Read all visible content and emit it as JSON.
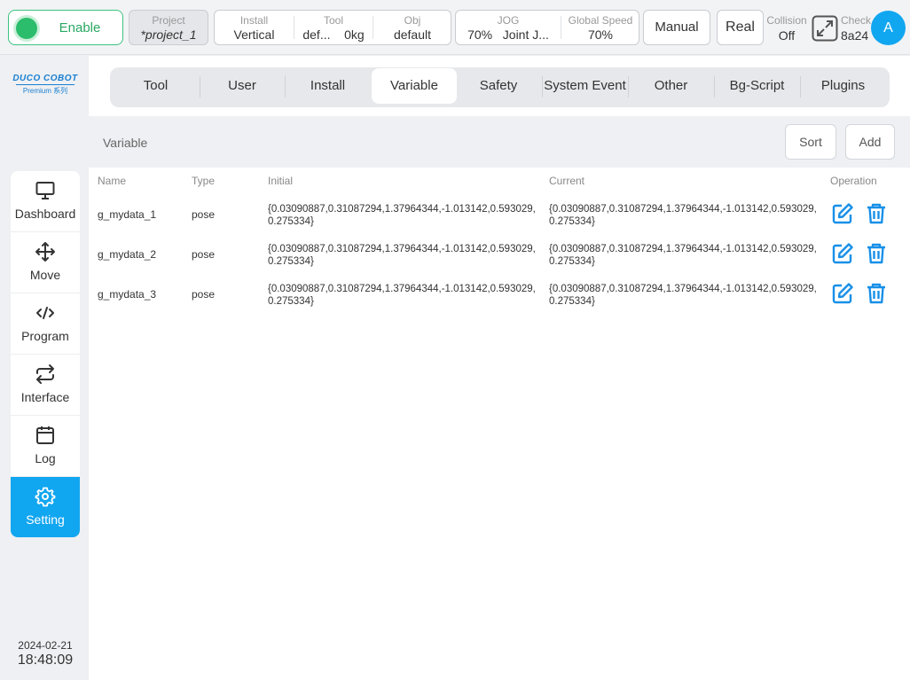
{
  "topbar": {
    "enable_label": "Enable",
    "project": {
      "label": "Project",
      "value": "*project_1"
    },
    "install": {
      "label": "Install",
      "value": "Vertical"
    },
    "tool": {
      "label": "Tool",
      "value1": "def...",
      "value2": "0kg"
    },
    "obj": {
      "label": "Obj",
      "value": "default"
    },
    "jog": {
      "label": "JOG",
      "value1": "70%",
      "value2": "Joint J..."
    },
    "global_speed": {
      "label": "Global Speed",
      "value": "70%"
    },
    "manual_label": "Manual",
    "real_label": "Real",
    "collision": {
      "label": "Collision",
      "value": "Off"
    },
    "check": {
      "label": "Check",
      "value": "8a24"
    },
    "avatar_letter": "A"
  },
  "logo": {
    "brand": "DUCO COBOT",
    "sub": "Premium 系列"
  },
  "nav": [
    {
      "label": "Dashboard",
      "icon": "monitor-icon"
    },
    {
      "label": "Move",
      "icon": "move-arrows-icon"
    },
    {
      "label": "Program",
      "icon": "code-icon"
    },
    {
      "label": "Interface",
      "icon": "repeat-icon"
    },
    {
      "label": "Log",
      "icon": "calendar-icon"
    },
    {
      "label": "Setting",
      "icon": "gear-icon",
      "active": true
    }
  ],
  "datetime": {
    "date": "2024-02-21",
    "time": "18:48:09"
  },
  "tabs": [
    "Tool",
    "User",
    "Install",
    "Variable",
    "Safety",
    "System Event",
    "Other",
    "Bg-Script",
    "Plugins"
  ],
  "active_tab": "Variable",
  "section": {
    "title": "Variable",
    "sort_label": "Sort",
    "add_label": "Add"
  },
  "table": {
    "headers": [
      "Name",
      "Type",
      "Initial",
      "Current",
      "Operation"
    ],
    "rows": [
      {
        "name": "g_mydata_1",
        "type": "pose",
        "initial": "{0.03090887,0.31087294,1.37964344,-1.013142,0.593029,0.275334}",
        "current": "{0.03090887,0.31087294,1.37964344,-1.013142,0.593029,0.275334}"
      },
      {
        "name": "g_mydata_2",
        "type": "pose",
        "initial": "{0.03090887,0.31087294,1.37964344,-1.013142,0.593029,0.275334}",
        "current": "{0.03090887,0.31087294,1.37964344,-1.013142,0.593029,0.275334}"
      },
      {
        "name": "g_mydata_3",
        "type": "pose",
        "initial": "{0.03090887,0.31087294,1.37964344,-1.013142,0.593029,0.275334}",
        "current": "{0.03090887,0.31087294,1.37964344,-1.013142,0.593029,0.275334}"
      }
    ]
  },
  "colors": {
    "accent": "#11a6f0",
    "enable_green": "#2bbd6b",
    "edit_blue": "#1890e8"
  }
}
